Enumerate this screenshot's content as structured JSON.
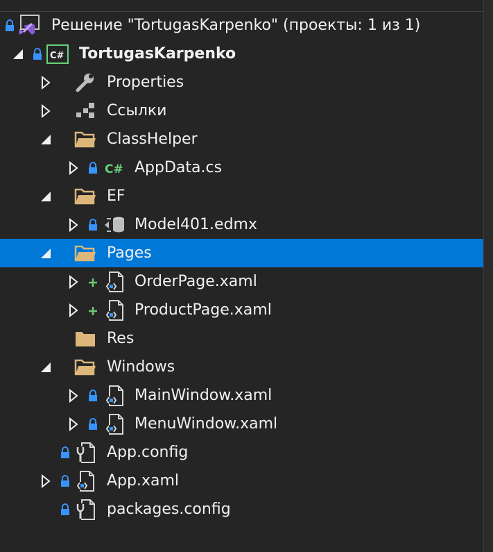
{
  "solution": {
    "label": "Решение \"TortugasKarpenko\" (проекты: 1 из 1)",
    "icon": "visual-studio-solution-icon"
  },
  "project": {
    "label": "TortugasKarpenko",
    "icon": "csharp-project-icon"
  },
  "items": {
    "properties": {
      "label": "Properties",
      "icon": "wrench-icon"
    },
    "references": {
      "label": "Ссылки",
      "icon": "references-icon"
    },
    "classhelper": {
      "label": "ClassHelper",
      "icon": "folder-open-icon"
    },
    "appdata": {
      "label": "AppData.cs",
      "icon": "csharp-file-icon"
    },
    "ef": {
      "label": "EF",
      "icon": "folder-open-icon"
    },
    "model": {
      "label": "Model401.edmx",
      "icon": "edmx-model-icon"
    },
    "pages": {
      "label": "Pages",
      "icon": "folder-open-icon"
    },
    "orderpage": {
      "label": "OrderPage.xaml",
      "icon": "xaml-file-icon"
    },
    "productpage": {
      "label": "ProductPage.xaml",
      "icon": "xaml-file-icon"
    },
    "res": {
      "label": "Res",
      "icon": "folder-closed-icon"
    },
    "windows": {
      "label": "Windows",
      "icon": "folder-open-icon"
    },
    "mainwindow": {
      "label": "MainWindow.xaml",
      "icon": "xaml-file-icon"
    },
    "menuwindow": {
      "label": "MenuWindow.xaml",
      "icon": "xaml-file-icon"
    },
    "appconfig": {
      "label": "App.config",
      "icon": "config-file-icon"
    },
    "appxaml": {
      "label": "App.xaml",
      "icon": "xaml-file-icon"
    },
    "packagesconfig": {
      "label": "packages.config",
      "icon": "config-file-icon"
    }
  },
  "colors": {
    "background": "#252526",
    "selection": "#0078d7",
    "text": "#f1f1f1",
    "folder": "#dcb67a",
    "lock": "#3794ff",
    "add": "#6ec76e",
    "csharp": "#6ad17a"
  }
}
